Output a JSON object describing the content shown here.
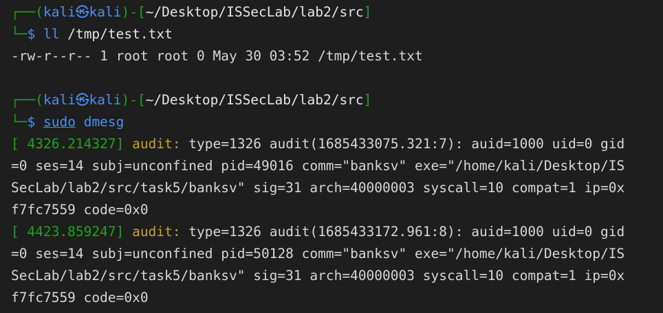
{
  "colors": {
    "background": "#1e1e1e",
    "prompt_green": "#1fa31f",
    "prompt_blue": "#4a8ff0",
    "audit_yellow": "#c9a227",
    "text": "#d7d7d7"
  },
  "prompt": {
    "box_top": "┌──",
    "box_bottom": "└─",
    "open_paren": "(",
    "user": "kali",
    "at_symbol": "㉿",
    "host": "kali",
    "close_paren": ")",
    "dash": "-",
    "open_bracket": "[",
    "path": "~/Desktop/ISSecLab/lab2/src",
    "close_bracket": "]",
    "dollar": "$"
  },
  "blocks": [
    {
      "command": {
        "name": "ll",
        "args": " /tmp/test.txt"
      },
      "output": [
        "-rw-r--r-- 1 root root 0 May 30 03:52 /tmp/test.txt"
      ]
    },
    {
      "command": {
        "prefix": "sudo",
        "name": "dmesg",
        "args": ""
      },
      "dmesg": [
        {
          "timestamp": "[ 4326.214327]",
          "label": "audit:",
          "lines": [
            " type=1326 audit(1685433075.321:7): auid=1000 uid=0 gid",
            "=0 ses=14 subj=unconfined pid=49016 comm=\"banksv\" exe=\"/home/kali/Desktop/IS",
            "SecLab/lab2/src/task5/banksv\" sig=31 arch=40000003 syscall=10 compat=1 ip=0x",
            "f7fc7559 code=0x0"
          ]
        },
        {
          "timestamp": "[ 4423.859247]",
          "label": "audit:",
          "lines": [
            " type=1326 audit(1685433172.961:8): auid=1000 uid=0 gid",
            "=0 ses=14 subj=unconfined pid=50128 comm=\"banksv\" exe=\"/home/kali/Desktop/IS",
            "SecLab/lab2/src/task5/banksv\" sig=31 arch=40000003 syscall=10 compat=1 ip=0x",
            "f7fc7559 code=0x0"
          ]
        }
      ]
    }
  ]
}
